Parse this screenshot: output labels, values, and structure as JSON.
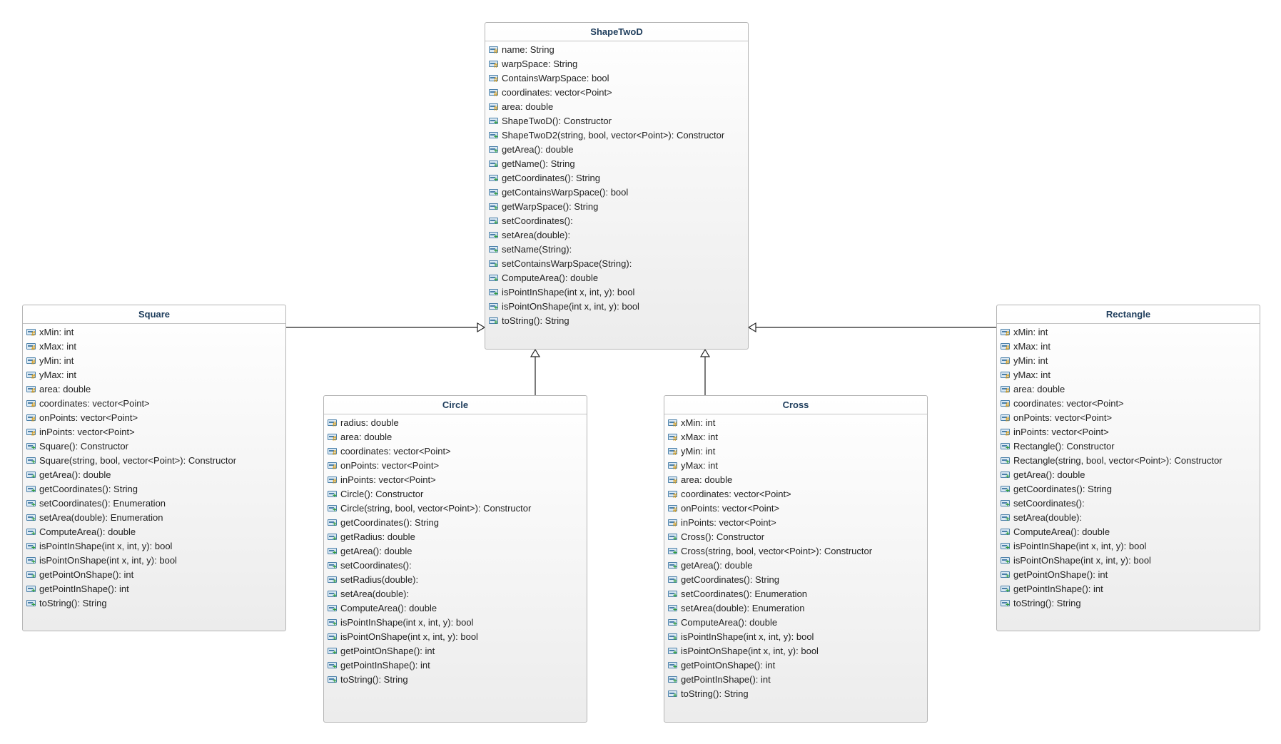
{
  "classes": [
    {
      "id": "shapetwod",
      "name": "ShapeTwoD",
      "members": [
        {
          "text": "name: String",
          "vis": "protected"
        },
        {
          "text": "warpSpace: String",
          "vis": "protected"
        },
        {
          "text": "ContainsWarpSpace: bool",
          "vis": "protected"
        },
        {
          "text": "coordinates: vector<Point>",
          "vis": "protected"
        },
        {
          "text": "area: double",
          "vis": "protected"
        },
        {
          "text": "ShapeTwoD(): Constructor",
          "vis": "public"
        },
        {
          "text": "ShapeTwoD2(string, bool, vector<Point>): Constructor",
          "vis": "public"
        },
        {
          "text": "getArea(): double",
          "vis": "public"
        },
        {
          "text": "getName(): String",
          "vis": "public"
        },
        {
          "text": "getCoordinates(): String",
          "vis": "public"
        },
        {
          "text": "getContainsWarpSpace(): bool",
          "vis": "public"
        },
        {
          "text": "getWarpSpace(): String",
          "vis": "public"
        },
        {
          "text": "setCoordinates():",
          "vis": "public"
        },
        {
          "text": "setArea(double):",
          "vis": "public"
        },
        {
          "text": "setName(String):",
          "vis": "public"
        },
        {
          "text": "setContainsWarpSpace(String):",
          "vis": "public"
        },
        {
          "text": "ComputeArea(): double",
          "vis": "public"
        },
        {
          "text": "isPointInShape(int x, int, y): bool",
          "vis": "public"
        },
        {
          "text": "isPointOnShape(int x, int, y): bool",
          "vis": "public"
        },
        {
          "text": "toString(): String",
          "vis": "public"
        }
      ]
    },
    {
      "id": "square",
      "name": "Square",
      "members": [
        {
          "text": "xMin: int",
          "vis": "protected"
        },
        {
          "text": "xMax: int",
          "vis": "protected"
        },
        {
          "text": "yMin: int",
          "vis": "protected"
        },
        {
          "text": "yMax: int",
          "vis": "protected"
        },
        {
          "text": "area: double",
          "vis": "protected"
        },
        {
          "text": "coordinates: vector<Point>",
          "vis": "protected"
        },
        {
          "text": "onPoints: vector<Point>",
          "vis": "protected"
        },
        {
          "text": "inPoints: vector<Point>",
          "vis": "protected"
        },
        {
          "text": "Square(): Constructor",
          "vis": "public"
        },
        {
          "text": "Square(string, bool, vector<Point>): Constructor",
          "vis": "public"
        },
        {
          "text": "getArea(): double",
          "vis": "public"
        },
        {
          "text": "getCoordinates(): String",
          "vis": "public"
        },
        {
          "text": "setCoordinates(): Enumeration",
          "vis": "public"
        },
        {
          "text": "setArea(double): Enumeration",
          "vis": "public"
        },
        {
          "text": "ComputeArea(): double",
          "vis": "public"
        },
        {
          "text": "isPointInShape(int x, int, y): bool",
          "vis": "public"
        },
        {
          "text": "isPointOnShape(int x, int, y): bool",
          "vis": "public"
        },
        {
          "text": "getPointOnShape(): int",
          "vis": "public"
        },
        {
          "text": "getPointInShape(): int",
          "vis": "public"
        },
        {
          "text": "toString(): String",
          "vis": "public"
        }
      ]
    },
    {
      "id": "circle",
      "name": "Circle",
      "members": [
        {
          "text": "radius: double",
          "vis": "protected"
        },
        {
          "text": "area: double",
          "vis": "protected"
        },
        {
          "text": "coordinates: vector<Point>",
          "vis": "protected"
        },
        {
          "text": "onPoints: vector<Point>",
          "vis": "protected"
        },
        {
          "text": "inPoints: vector<Point>",
          "vis": "protected"
        },
        {
          "text": "Circle(): Constructor",
          "vis": "public"
        },
        {
          "text": "Circle(string, bool, vector<Point>): Constructor",
          "vis": "public"
        },
        {
          "text": "getCoordinates(): String",
          "vis": "public"
        },
        {
          "text": "getRadius: double",
          "vis": "public"
        },
        {
          "text": "getArea(): double",
          "vis": "public"
        },
        {
          "text": "setCoordinates():",
          "vis": "public"
        },
        {
          "text": "setRadius(double):",
          "vis": "public"
        },
        {
          "text": "setArea(double):",
          "vis": "public"
        },
        {
          "text": "ComputeArea(): double",
          "vis": "public"
        },
        {
          "text": "isPointInShape(int x, int, y): bool",
          "vis": "public"
        },
        {
          "text": "isPointOnShape(int x, int, y): bool",
          "vis": "public"
        },
        {
          "text": "getPointOnShape(): int",
          "vis": "public"
        },
        {
          "text": "getPointInShape(): int",
          "vis": "public"
        },
        {
          "text": "toString(): String",
          "vis": "public"
        }
      ]
    },
    {
      "id": "cross",
      "name": "Cross",
      "members": [
        {
          "text": "xMin: int",
          "vis": "protected"
        },
        {
          "text": "xMax: int",
          "vis": "protected"
        },
        {
          "text": "yMin: int",
          "vis": "protected"
        },
        {
          "text": "yMax: int",
          "vis": "protected"
        },
        {
          "text": "area: double",
          "vis": "protected"
        },
        {
          "text": "coordinates: vector<Point>",
          "vis": "protected"
        },
        {
          "text": "onPoints: vector<Point>",
          "vis": "protected"
        },
        {
          "text": "inPoints: vector<Point>",
          "vis": "protected"
        },
        {
          "text": "Cross(): Constructor",
          "vis": "public"
        },
        {
          "text": "Cross(string, bool, vector<Point>): Constructor",
          "vis": "public"
        },
        {
          "text": "getArea(): double",
          "vis": "public"
        },
        {
          "text": "getCoordinates(): String",
          "vis": "public"
        },
        {
          "text": "setCoordinates(): Enumeration",
          "vis": "public"
        },
        {
          "text": "setArea(double): Enumeration",
          "vis": "public"
        },
        {
          "text": "ComputeArea(): double",
          "vis": "public"
        },
        {
          "text": "isPointInShape(int x, int, y): bool",
          "vis": "public"
        },
        {
          "text": "isPointOnShape(int x, int, y): bool",
          "vis": "public"
        },
        {
          "text": "getPointOnShape(): int",
          "vis": "public"
        },
        {
          "text": "getPointInShape(): int",
          "vis": "public"
        },
        {
          "text": "toString(): String",
          "vis": "public"
        }
      ]
    },
    {
      "id": "rectangle",
      "name": "Rectangle",
      "members": [
        {
          "text": "xMin: int",
          "vis": "protected"
        },
        {
          "text": "xMax: int",
          "vis": "protected"
        },
        {
          "text": "yMin: int",
          "vis": "protected"
        },
        {
          "text": "yMax: int",
          "vis": "protected"
        },
        {
          "text": "area: double",
          "vis": "protected"
        },
        {
          "text": "coordinates: vector<Point>",
          "vis": "protected"
        },
        {
          "text": "onPoints: vector<Point>",
          "vis": "protected"
        },
        {
          "text": "inPoints: vector<Point>",
          "vis": "protected"
        },
        {
          "text": "Rectangle(): Constructor",
          "vis": "public"
        },
        {
          "text": "Rectangle(string, bool, vector<Point>): Constructor",
          "vis": "public"
        },
        {
          "text": "getArea(): double",
          "vis": "public"
        },
        {
          "text": "getCoordinates(): String",
          "vis": "public"
        },
        {
          "text": "setCoordinates():",
          "vis": "public"
        },
        {
          "text": "setArea(double):",
          "vis": "public"
        },
        {
          "text": "ComputeArea(): double",
          "vis": "public"
        },
        {
          "text": "isPointInShape(int x, int, y): bool",
          "vis": "public"
        },
        {
          "text": "isPointOnShape(int x, int, y): bool",
          "vis": "public"
        },
        {
          "text": "getPointOnShape(): int",
          "vis": "public"
        },
        {
          "text": "getPointInShape(): int",
          "vis": "public"
        },
        {
          "text": "toString(): String",
          "vis": "public"
        }
      ]
    }
  ],
  "generalizations": [
    {
      "from": "square",
      "to": "shapetwod"
    },
    {
      "from": "circle",
      "to": "shapetwod"
    },
    {
      "from": "cross",
      "to": "shapetwod"
    },
    {
      "from": "rectangle",
      "to": "shapetwod"
    }
  ],
  "colors": {
    "title": "#1e3d5c",
    "protected_marker": "#d89a12",
    "public_marker": "#2c9a3c",
    "line": "#222222"
  }
}
